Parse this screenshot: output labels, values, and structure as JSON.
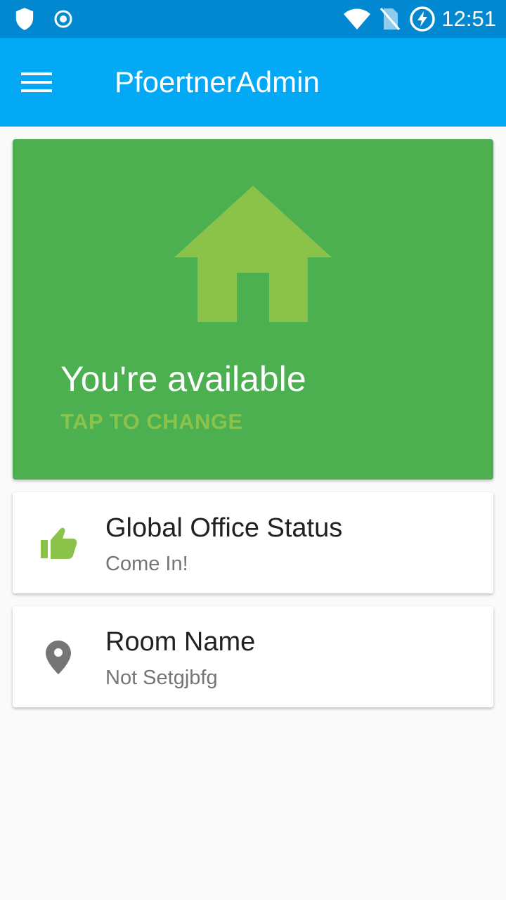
{
  "status_bar": {
    "time": "12:51",
    "icons": [
      "shield-icon",
      "sync-icon",
      "wifi-icon",
      "no-sim-icon",
      "battery-charging-icon"
    ]
  },
  "app_bar": {
    "title": "PfoertnerAdmin",
    "menu_icon": "menu-icon"
  },
  "availability_card": {
    "icon": "home-icon",
    "title": "You're available",
    "action": "TAP TO CHANGE",
    "colors": {
      "background": "#4caf50",
      "accent": "#8bc34a"
    }
  },
  "office_status_card": {
    "icon": "thumb-up-icon",
    "title": "Global Office Status",
    "subtitle": "Come In!"
  },
  "room_card": {
    "icon": "location-pin-icon",
    "title": "Room Name",
    "subtitle": "Not Setgjbfg"
  },
  "colors": {
    "status_bar": "#0288d1",
    "app_bar": "#03a9f4",
    "page_background": "#fafafa"
  }
}
